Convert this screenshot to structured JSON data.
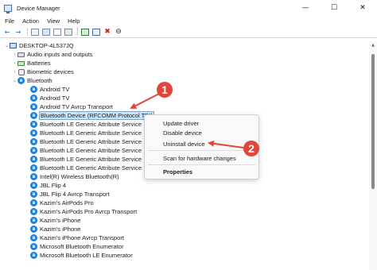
{
  "window": {
    "title": "Device Manager",
    "controls": {
      "minimize": "—",
      "maximize": "☐",
      "close": "✕"
    }
  },
  "menu": [
    "File",
    "Action",
    "View",
    "Help"
  ],
  "toolbar": {
    "icons": [
      "back-arrow-icon",
      "forward-arrow-icon",
      "properties-icon",
      "show-hide-icon",
      "help-icon",
      "details-icon",
      "scan-icon",
      "update-driver-icon",
      "uninstall-icon",
      "disable-icon"
    ],
    "back_glyph": "←",
    "forward_glyph": "→",
    "uninstall_glyph": "✖",
    "disable_glyph": "⊖"
  },
  "tree": {
    "expand_glyph": "⌄",
    "collapse_glyph": "›",
    "bt_glyph": "ʙ",
    "root": "DESKTOP-4L537JQ",
    "categories": [
      {
        "label": "Audio inputs and outputs",
        "icon": "speaker-icon"
      },
      {
        "label": "Batteries",
        "icon": "battery-icon"
      },
      {
        "label": "Biometric devices",
        "icon": "fingerprint-icon"
      },
      {
        "label": "Bluetooth",
        "icon": "bluetooth-icon"
      }
    ],
    "bluetooth_devices": [
      "Android TV",
      "Android TV",
      "Android TV Avrcp Transport",
      "Bluetooth Device (RFCOMM Protocol TDI)",
      "Bluetooth LE Generic Attribute Service",
      "Bluetooth LE Generic Attribute Service",
      "Bluetooth LE Generic Attribute Service",
      "Bluetooth LE Generic Attribute Service",
      "Bluetooth LE Generic Attribute Service",
      "Bluetooth LE Generic Attribute Service",
      "Intel(R) Wireless Bluetooth(R)",
      "JBL Flip 4",
      "JBL Flip 4 Avrcp Transport",
      "Kazim's AirPods Pro",
      "Kazim's AirPods Pro Avrcp Transport",
      "Kazim's iPhone",
      "Kazim's iPhone",
      "Kazim's iPhone Avrcp Transport",
      "Microsoft Bluetooth Enumerator",
      "Microsoft Bluetooth LE Enumerator"
    ],
    "selected_index": 3
  },
  "context_menu": {
    "update_driver": "Update driver",
    "disable_device": "Disable device",
    "uninstall_device": "Uninstall device",
    "scan": "Scan for hardware changes",
    "properties": "Properties"
  },
  "annotations": {
    "color": "#e0463a",
    "badge1": "1",
    "badge2": "2"
  },
  "scrollbar": {
    "up_glyph": "▲"
  }
}
